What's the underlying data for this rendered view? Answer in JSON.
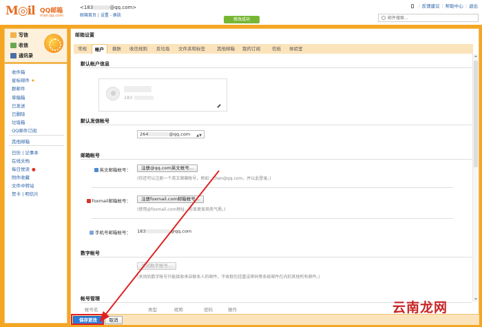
{
  "header": {
    "logo_moil": "M◎il",
    "logo_qqmail": "QQ邮箱",
    "logo_domain": "mail.qq.com",
    "account_prefix": "<183",
    "account_suffix": "@qq.com>",
    "account_links": [
      "邮箱首页",
      "设置",
      "换肤"
    ],
    "toast": "修改成功",
    "top_links": [
      "反馈建议",
      "帮助中心",
      "退出"
    ],
    "search_placeholder": "邮件搜索..."
  },
  "sidebar": {
    "write": "写信",
    "receive": "收信",
    "contacts": "通讯录",
    "folders": [
      "收件箱",
      "星标邮件",
      "群邮件",
      "草稿箱",
      "已发送",
      "已删除",
      "垃圾箱",
      "QQ邮件订阅"
    ],
    "other": "其他邮箱",
    "tools": [
      "日历 | 记事本",
      "在线文档",
      "每日悦读",
      "附件收藏",
      "文件中转站",
      "贺卡 | 明信片"
    ]
  },
  "main": {
    "title": "邮箱设置",
    "tabs": [
      "常规",
      "帐户",
      "换肤",
      "收信规则",
      "反垃圾",
      "文件夹和标签",
      "其他邮箱",
      "我的订阅",
      "信纸",
      "体验室"
    ],
    "active_tab": "帐户",
    "sections": {
      "default_info": "默认帐户信息",
      "default_sender": "默认发信帐号",
      "mail_accounts": "邮箱帐号",
      "digit_account": "数字帐号",
      "account_manage": "帐号管理"
    },
    "card_num_prefix": "183",
    "sender_prefix": "264",
    "sender_suffix": "@qq.com",
    "english_label": "英文邮箱帐号：",
    "english_button": "注册@qq.com英文帐号...",
    "english_hint": "(你还可以注册一个英文邮箱帐号，例如：chen@qq.com，并以此登录。)",
    "foxmail_label": "foxmail邮箱帐号：",
    "foxmail_button": "注册foxmail.com邮箱帐号...",
    "foxmail_hint": "(使用@foxmail.com地址，彰显更显商务气质。)",
    "phone_label": "手机号邮箱帐号：",
    "phone_prefix": "183",
    "phone_suffix": "@qq.com",
    "digit_button": "关闭数字帐号...",
    "digit_hint": "(关闭后数字帐号只能接收来自联系人的邮件，不收取包括重设密码等系统邮件在内的其他所有邮件。)",
    "columns": [
      "帐号名",
      "类型",
      "昵称",
      "密码",
      "操作"
    ]
  },
  "footer": {
    "save": "保存更改",
    "cancel": "取消"
  },
  "watermark": "云南龙网",
  "colors": {
    "accent": "#f4a623",
    "tab_bg": "#fbe3bb",
    "save": "#2c7bd8",
    "arrow": "#e02020",
    "toast": "#77b633"
  }
}
